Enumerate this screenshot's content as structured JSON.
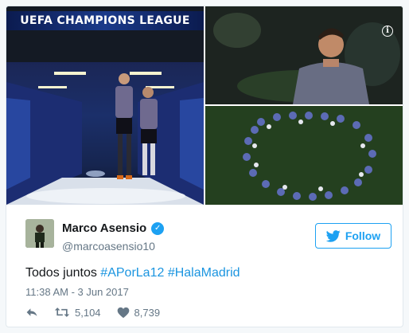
{
  "media": {
    "banner_text": "UEFA CHAMPIONS LEAGUE",
    "info_icon": "info-icon"
  },
  "user": {
    "display_name": "Marco Asensio",
    "handle": "@marcoasensio10",
    "verified_icon": "verified-badge-icon"
  },
  "follow_button": {
    "label": "Follow",
    "icon": "twitter-bird-icon"
  },
  "tweet": {
    "text_plain": "Todos juntos",
    "hashtags": [
      "#APorLa12",
      "#HalaMadrid"
    ],
    "timestamp": "11:38 AM - 3 Jun 2017"
  },
  "actions": {
    "reply_icon": "reply-icon",
    "retweet_icon": "retweet-icon",
    "retweet_count": "5,104",
    "like_icon": "heart-icon",
    "like_count": "8,739"
  },
  "colors": {
    "accent": "#1da1f2",
    "hashtag": "#1b95e0",
    "muted": "#657786",
    "text": "#14171a"
  }
}
